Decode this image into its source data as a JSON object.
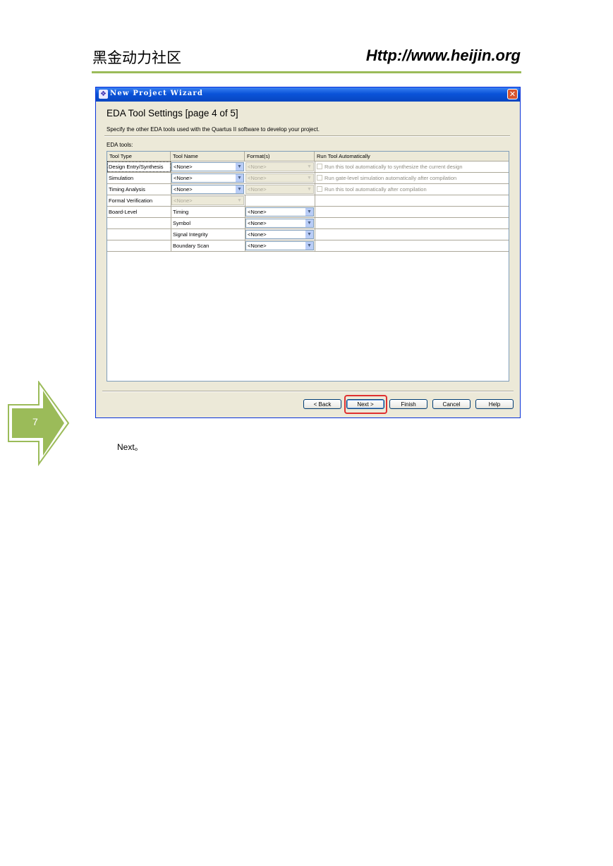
{
  "header": {
    "left_title": "黑金动力社区",
    "right_url": "Http://www.heijin.org"
  },
  "window": {
    "title": "New Project Wizard",
    "page_title": "EDA Tool Settings [page 4 of 5]",
    "description": "Specify the other EDA tools used with the Quartus II software to develop your project.",
    "eda_label": "EDA tools:",
    "columns": [
      "Tool Type",
      "Tool Name",
      "Format(s)",
      "Run Tool Automatically"
    ],
    "rows": [
      {
        "type": "Design Entry/Synthesis",
        "tool": "<None>",
        "format": "<None>",
        "run": "Run this tool automatically to synthesize the current design"
      },
      {
        "type": "Simulation",
        "tool": "<None>",
        "format": "<None>",
        "run": "Run gate-level simulation automatically after compilation"
      },
      {
        "type": "Timing Analysis",
        "tool": "<None>",
        "format": "<None>",
        "run": "Run this tool automatically after compilation"
      },
      {
        "type": "Formal Verification",
        "tool": "<None>"
      },
      {
        "type": "Board-Level",
        "tool": "Timing",
        "format": "<None>"
      },
      {
        "type": "",
        "tool": "Symbol",
        "format": "<None>"
      },
      {
        "type": "",
        "tool": "Signal Integrity",
        "format": "<None>"
      },
      {
        "type": "",
        "tool": "Boundary Scan",
        "format": "<None>"
      }
    ],
    "buttons": {
      "back": "< Back",
      "next": "Next >",
      "finish": "Finish",
      "cancel": "Cancel",
      "help": "Help"
    }
  },
  "step": {
    "number": "7",
    "caption": "Next。"
  },
  "colors": {
    "accent_rule": "#9bbb59",
    "step_arrow": "#9bbb59",
    "highlight": "#e03030"
  }
}
